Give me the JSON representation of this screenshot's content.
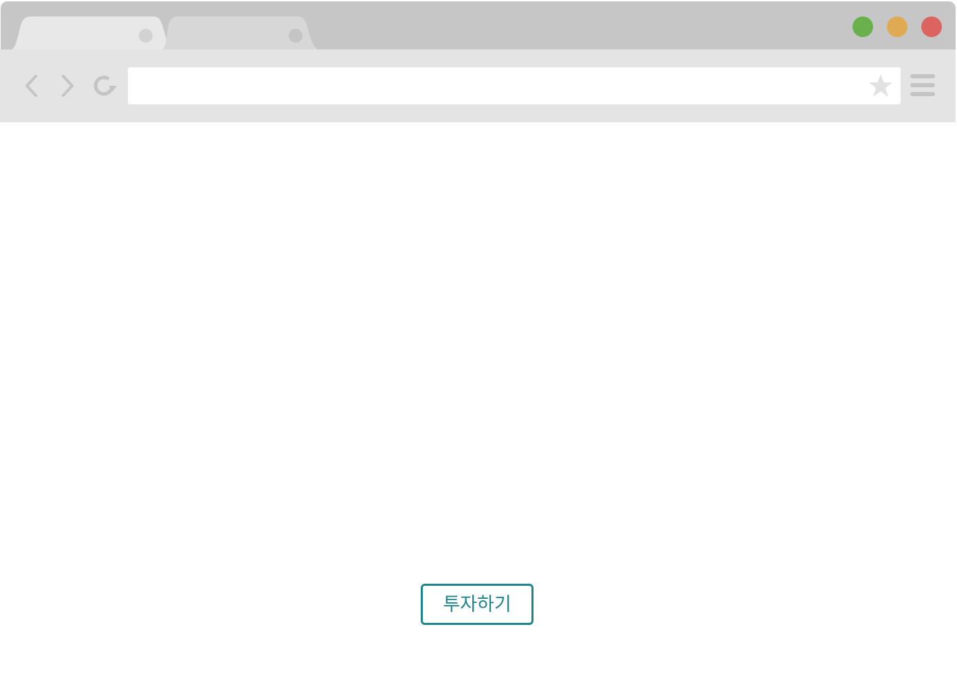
{
  "browser": {
    "tabs": [
      {
        "label": "",
        "active": true
      },
      {
        "label": "",
        "active": false
      }
    ],
    "window_controls": [
      {
        "name": "green-window-button",
        "color": "#6ab04c"
      },
      {
        "name": "yellow-window-button",
        "color": "#e0aa55"
      },
      {
        "name": "red-window-button",
        "color": "#dc6460"
      }
    ],
    "address_bar": {
      "value": "",
      "placeholder": ""
    },
    "icons": {
      "back": "chevron-left-icon",
      "forward": "chevron-right-icon",
      "reload": "reload-icon",
      "bookmark": "star-icon",
      "menu": "hamburger-menu-icon"
    }
  },
  "page": {
    "invest_button_label": "투자하기"
  },
  "colors": {
    "accent": "#1f858c",
    "titlebar": "#c6c6c6",
    "toolbar": "#e4e4e4",
    "icon_gray": "#c4c4c4"
  }
}
